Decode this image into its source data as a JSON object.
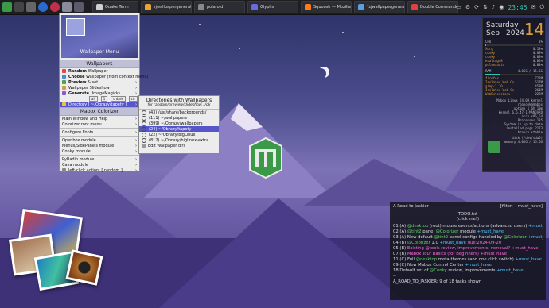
{
  "taskbar": {
    "tasks": [
      {
        "label": "Quake Term",
        "color": "#cfcfcf"
      },
      {
        "label": "zjwallpapergenerate",
        "color": "#e8a33a"
      },
      {
        "label": "polaroid",
        "color": "#888888"
      },
      {
        "label": "Glyphs",
        "color": "#6a6ae0"
      },
      {
        "label": "Squoosh — Mozilla F",
        "color": "#ff7a1a"
      },
      {
        "label": "*zjwallpapergenerat",
        "color": "#5aa0e0"
      },
      {
        "label": "Double Commander",
        "color": "#e04040"
      }
    ],
    "clock": "23:45"
  },
  "menu": {
    "thumb_label": "Wallpaper Menu",
    "section_wallpapers": "Wallpapers",
    "items": [
      {
        "bold": "Random",
        "rest": " Wallpaper"
      },
      {
        "bold": "Choose",
        "rest": " Wallpaper (from context menu)"
      },
      {
        "bold": "Preview",
        "rest": " & set"
      },
      {
        "bold": "",
        "rest": "Wallpaper Slideshow"
      },
      {
        "bold": "Generate",
        "rest": " (ImageMagick)..."
      }
    ],
    "swatches": [
      "all",
      "1",
      "c dark",
      "ctr",
      "Dim"
    ],
    "directory_item": "Directory [ ~/Obrazy/tapety ]",
    "section_colorizer": "Mabox Colorizer",
    "col_items": [
      "Main Window and Help",
      "Colorizer root menu",
      "Configure Fonts",
      "Openbox module",
      "Menus/SidePanels module",
      "Conky module",
      "PyRadio module",
      "Cava module"
    ],
    "left_click": "left-click action: [ random ]"
  },
  "submenu": {
    "title": "Directories with Wallpapers",
    "subtitle": "for random/preview/slideshow.../dk",
    "dirs": [
      "(43) /usr/share/backgrounds/",
      "(111) ~/wallpapers",
      "(399) ~/Obrazy/wallpapers",
      "(24) ~/Obrazy/tapety",
      "(22) ~/Obrazy/bigLinux",
      "(812) ~/Obrazy/biglinux-extra"
    ],
    "edit": "Edit Wallpaper dirs"
  },
  "conky": {
    "day": "Saturday",
    "month": "Sep",
    "date": "14",
    "year": "2024",
    "cpu_label": "CPU",
    "cpu_value": "1%",
    "cpu_procs": [
      {
        "name": "Xorg",
        "val": "0.13%"
      },
      {
        "name": "conky",
        "val": "0.09%"
      },
      {
        "name": "conky",
        "val": "0.08%"
      },
      {
        "name": "kcalcmgr8",
        "val": "0.05%"
      },
      {
        "name": "pulseaudio",
        "val": "0.03%"
      }
    ],
    "ram_label": "RAM",
    "ram_value": "4.05G / 15.6G",
    "ram_procs": [
      {
        "name": "firefox",
        "val": "722M"
      },
      {
        "name": "Isolated Web Co",
        "val": "617M"
      },
      {
        "name": "gimp-2.10",
        "val": "458M"
      },
      {
        "name": "Isolated Web Co",
        "val": "261M"
      },
      {
        "name": "WebExtensions",
        "val": "225M"
      }
    ],
    "system_info": [
      "Mabox Linux 24.09 kernel",
      "rogkonk@mabox",
      "uptime 1 6h 10m",
      "kernel 6.6.47-1-MANJARO",
      "arch x86_64",
      "Processes 185",
      "System is up to date",
      "installed pkgs 2173",
      "branch stable"
    ],
    "disk_info": [
      "disk (/dev/sda5)",
      "memory 4.05G / 15.6G"
    ],
    "cpu_bar_fraction": 0.02,
    "ram_bar_fraction": 0.26
  },
  "todo": {
    "header_left": "A Road to Jaskier",
    "header_right": "[filter: +must_have]",
    "file": "TODO.txt",
    "hint": "(click me!)",
    "lines": [
      [
        {
          "t": "01 (A) ",
          "c": ""
        },
        {
          "t": "@desktop",
          "c": "c-green"
        },
        {
          "t": " (root) mouse events/actions (advanced users) ",
          "c": ""
        },
        {
          "t": "+must_have",
          "c": "c-cyan"
        }
      ],
      [
        {
          "t": "02 (A) ",
          "c": ""
        },
        {
          "t": "@tint2",
          "c": "c-green"
        },
        {
          "t": " panel ",
          "c": ""
        },
        {
          "t": "@Colorizer",
          "c": "c-green"
        },
        {
          "t": " module ",
          "c": ""
        },
        {
          "t": "+must_have",
          "c": "c-cyan"
        }
      ],
      [
        {
          "t": "03 (A) New default ",
          "c": ""
        },
        {
          "t": "@tint2",
          "c": "c-green"
        },
        {
          "t": " panel configs handled by ",
          "c": ""
        },
        {
          "t": "@Colorizer",
          "c": "c-green"
        },
        {
          "t": " +must_have",
          "c": "c-cyan"
        }
      ],
      [
        {
          "t": "04 (B) ",
          "c": ""
        },
        {
          "t": "@Colorizer",
          "c": "c-green"
        },
        {
          "t": " 1.0 ",
          "c": ""
        },
        {
          "t": "+must_have",
          "c": "c-cyan"
        },
        {
          "t": " due:2024-09-20",
          "c": "c-pink"
        }
      ],
      [
        {
          "t": "05 (B) ",
          "c": ""
        },
        {
          "t": "Existing @tools review, improvements, removal? +must_have",
          "c": "c-pink"
        }
      ],
      [
        {
          "t": "07 (B) ",
          "c": ""
        },
        {
          "t": "Mabox Tour Basics (for Beginners) +must_have",
          "c": "c-pink"
        }
      ],
      [
        {
          "t": "11 (C) Full ",
          "c": ""
        },
        {
          "t": "@desktop",
          "c": "c-green"
        },
        {
          "t": " meta-themes (and one click switch) ",
          "c": ""
        },
        {
          "t": "+must_have",
          "c": "c-cyan"
        }
      ],
      [
        {
          "t": "09 (C) New Mabox Control Center ",
          "c": ""
        },
        {
          "t": "+must_have",
          "c": "c-cyan"
        }
      ],
      [
        {
          "t": "18 Default set of ",
          "c": ""
        },
        {
          "t": "@Conky",
          "c": "c-green"
        },
        {
          "t": " review, improvements ",
          "c": ""
        },
        {
          "t": "+must_have",
          "c": "c-cyan"
        }
      ]
    ],
    "dashes": "--",
    "footer": "A_ROAD_TO_JASKIER: 9 of 18 tasks shown"
  },
  "colors": {
    "accent": "#5656c9",
    "conky_orange": "#d89a3a",
    "conky_teal": "#2ec4b6",
    "mabox_green": "#3a9a48"
  }
}
